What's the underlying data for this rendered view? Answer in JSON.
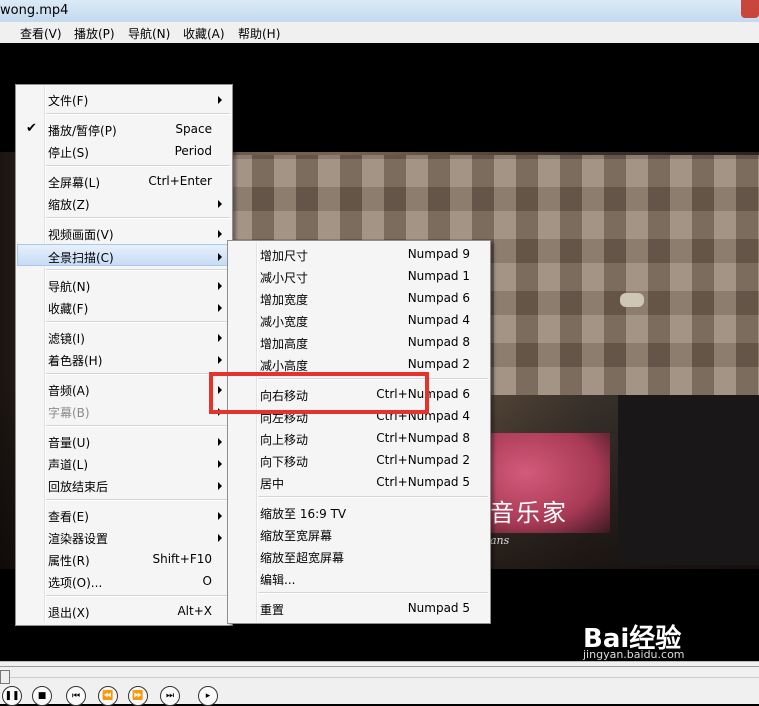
{
  "window": {
    "title": "wong.mp4"
  },
  "menubar": [
    "查看(V)",
    "播放(P)",
    "导航(N)",
    "收藏(A)",
    "帮助(H)"
  ],
  "main_menu": [
    {
      "label": "文件(F)",
      "submenu": true
    },
    {
      "sep": true
    },
    {
      "label": "播放/暂停(P)",
      "shortcut": "Space",
      "checked": true
    },
    {
      "label": "停止(S)",
      "shortcut": "Period"
    },
    {
      "sep": true
    },
    {
      "label": "全屏幕(L)",
      "shortcut": "Ctrl+Enter"
    },
    {
      "label": "缩放(Z)",
      "submenu": true
    },
    {
      "sep": true
    },
    {
      "label": "视频画面(V)",
      "submenu": true
    },
    {
      "label": "全景扫描(C)",
      "submenu": true,
      "highlighted": true
    },
    {
      "sep": true
    },
    {
      "label": "导航(N)",
      "submenu": true
    },
    {
      "label": "收藏(F)",
      "submenu": true
    },
    {
      "sep": true
    },
    {
      "label": "滤镜(I)",
      "submenu": true
    },
    {
      "label": "着色器(H)",
      "submenu": true
    },
    {
      "sep": true
    },
    {
      "label": "音频(A)",
      "submenu": true
    },
    {
      "label": "字幕(B)",
      "submenu": true,
      "disabled": true
    },
    {
      "sep": true
    },
    {
      "label": "音量(U)",
      "submenu": true
    },
    {
      "label": "声道(L)",
      "submenu": true
    },
    {
      "label": "回放结束后",
      "submenu": true
    },
    {
      "sep": true
    },
    {
      "label": "查看(E)",
      "submenu": true
    },
    {
      "label": "渲染器设置",
      "submenu": true
    },
    {
      "label": "属性(R)",
      "shortcut": "Shift+F10"
    },
    {
      "label": "选项(O)...",
      "shortcut": "O"
    },
    {
      "sep": true
    },
    {
      "label": "退出(X)",
      "shortcut": "Alt+X"
    }
  ],
  "pan_scan_menu": [
    {
      "label": "增加尺寸",
      "shortcut": "Numpad 9"
    },
    {
      "label": "减小尺寸",
      "shortcut": "Numpad 1"
    },
    {
      "label": "增加宽度",
      "shortcut": "Numpad 6"
    },
    {
      "label": "减小宽度",
      "shortcut": "Numpad 4"
    },
    {
      "label": "增加高度",
      "shortcut": "Numpad 8"
    },
    {
      "label": "减小高度",
      "shortcut": "Numpad 2"
    },
    {
      "sep": true
    },
    {
      "label": "向右移动",
      "shortcut": "Ctrl+Numpad 6"
    },
    {
      "label": "向左移动",
      "shortcut": "Ctrl+Numpad 4"
    },
    {
      "label": "向上移动",
      "shortcut": "Ctrl+Numpad 8"
    },
    {
      "label": "向下移动",
      "shortcut": "Ctrl+Numpad 2"
    },
    {
      "label": "居中",
      "shortcut": "Ctrl+Numpad 5"
    },
    {
      "sep": true
    },
    {
      "label": "缩放至 16:9 TV"
    },
    {
      "label": "缩放至宽屏幕"
    },
    {
      "label": "缩放至超宽屏幕"
    },
    {
      "label": "编辑..."
    },
    {
      "sep": true
    },
    {
      "label": "重置",
      "shortcut": "Numpad 5"
    }
  ],
  "video": {
    "subtitle": "音乐家",
    "subtitle_sub": "ans"
  },
  "watermark": {
    "main": "Bai经验",
    "sub": "jingyan.baidu.com"
  },
  "colors": {
    "highlight_box": "#e5322d",
    "menu_bg": "#f5f5f5"
  }
}
